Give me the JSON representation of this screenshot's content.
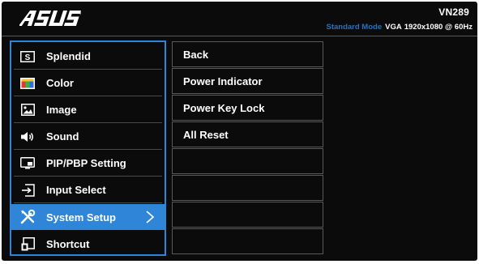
{
  "header": {
    "brand": "ASUS",
    "model": "VN289",
    "status": {
      "mode": "Standard Mode",
      "input": "VGA",
      "resolution": "1920x1080 @ 60Hz"
    }
  },
  "main_menu": {
    "items": [
      {
        "label": "Splendid",
        "icon": "splendid-s-icon"
      },
      {
        "label": "Color",
        "icon": "color-palette-icon"
      },
      {
        "label": "Image",
        "icon": "image-icon"
      },
      {
        "label": "Sound",
        "icon": "speaker-icon"
      },
      {
        "label": "PIP/PBP Setting",
        "icon": "pip-icon"
      },
      {
        "label": "Input Select",
        "icon": "input-select-icon"
      },
      {
        "label": "System Setup",
        "icon": "tools-icon",
        "selected": true
      },
      {
        "label": "Shortcut",
        "icon": "shortcut-icon"
      }
    ]
  },
  "sub_menu": {
    "items": [
      {
        "label": "Back"
      },
      {
        "label": "Power Indicator"
      },
      {
        "label": "Power Key Lock"
      },
      {
        "label": "All Reset"
      },
      {
        "label": ""
      },
      {
        "label": ""
      },
      {
        "label": ""
      },
      {
        "label": ""
      }
    ]
  },
  "colors": {
    "background": "#0b0b0b",
    "accent": "#2f86d8",
    "mode_text": "#1f73c6",
    "text": "#ffffff"
  }
}
